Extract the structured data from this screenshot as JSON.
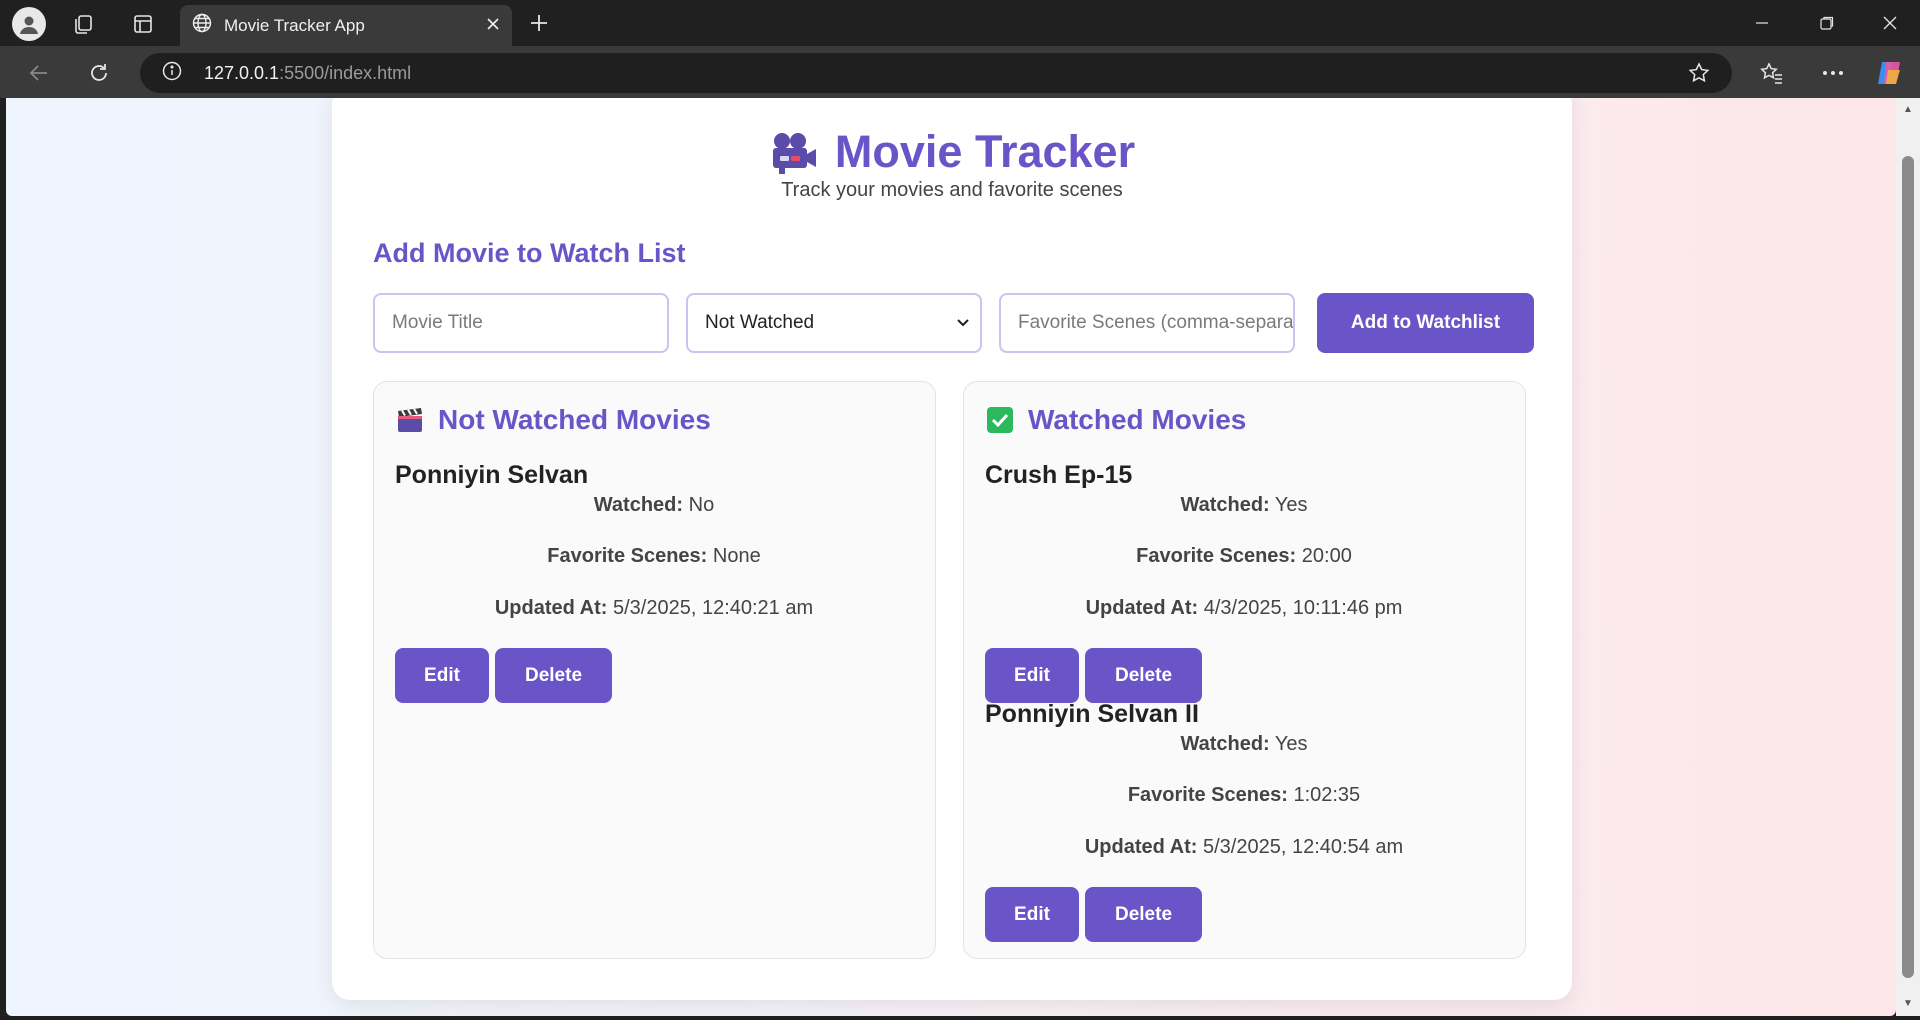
{
  "browser": {
    "tab_title": "Movie Tracker App",
    "url_host": "127.0.0.1",
    "url_rest": ":5500/index.html"
  },
  "app": {
    "title": "Movie Tracker",
    "subtitle": "Track your movies and favorite scenes",
    "accent_color": "#6a55c8"
  },
  "form": {
    "section_title": "Add Movie to Watch List",
    "title_placeholder": "Movie Title",
    "status_selected": "Not Watched",
    "scenes_placeholder": "Favorite Scenes (comma-separated)",
    "add_label": "Add to Watchlist"
  },
  "labels": {
    "watched": "Watched:",
    "favorite_scenes": "Favorite Scenes:",
    "updated_at": "Updated At:",
    "edit": "Edit",
    "delete": "Delete"
  },
  "not_watched": {
    "title": "Not Watched Movies",
    "icon": "clapper-board-icon",
    "movies": [
      {
        "name": "Ponniyin Selvan",
        "watched": "No",
        "scenes": "None",
        "updated": "5/3/2025, 12:40:21 am"
      }
    ]
  },
  "watched": {
    "title": "Watched Movies",
    "icon": "check-box-icon",
    "movies": [
      {
        "name": "Crush Ep-15",
        "watched": "Yes",
        "scenes": "20:00",
        "updated": "4/3/2025, 10:11:46 pm"
      },
      {
        "name": "Ponniyin Selvan II",
        "watched": "Yes",
        "scenes": "1:02:35",
        "updated": "5/3/2025, 12:40:54 am"
      }
    ]
  }
}
